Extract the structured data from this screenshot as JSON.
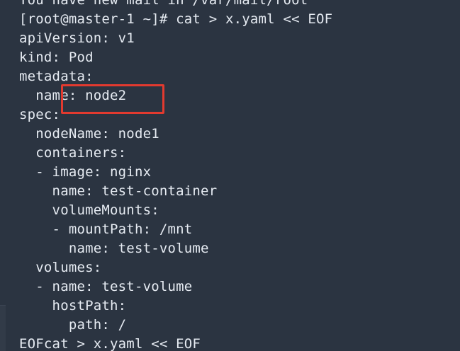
{
  "terminal": {
    "lines": [
      "You have new mail in /var/mail/root",
      "[root@master-1 ~]# cat > x.yaml << EOF",
      "apiVersion: v1",
      "kind: Pod",
      "metadata:",
      "  name: node2",
      "spec:",
      "  nodeName: node1",
      "  containers:",
      "  - image: nginx",
      "    name: test-container",
      "    volumeMounts:",
      "    - mountPath: /mnt",
      "      name: test-volume",
      "  volumes:",
      "  - name: test-volume",
      "    hostPath:",
      "      path: /",
      "EOFcat > x.yaml << EOF"
    ]
  },
  "annotation": {
    "color": "#e23a2f"
  }
}
